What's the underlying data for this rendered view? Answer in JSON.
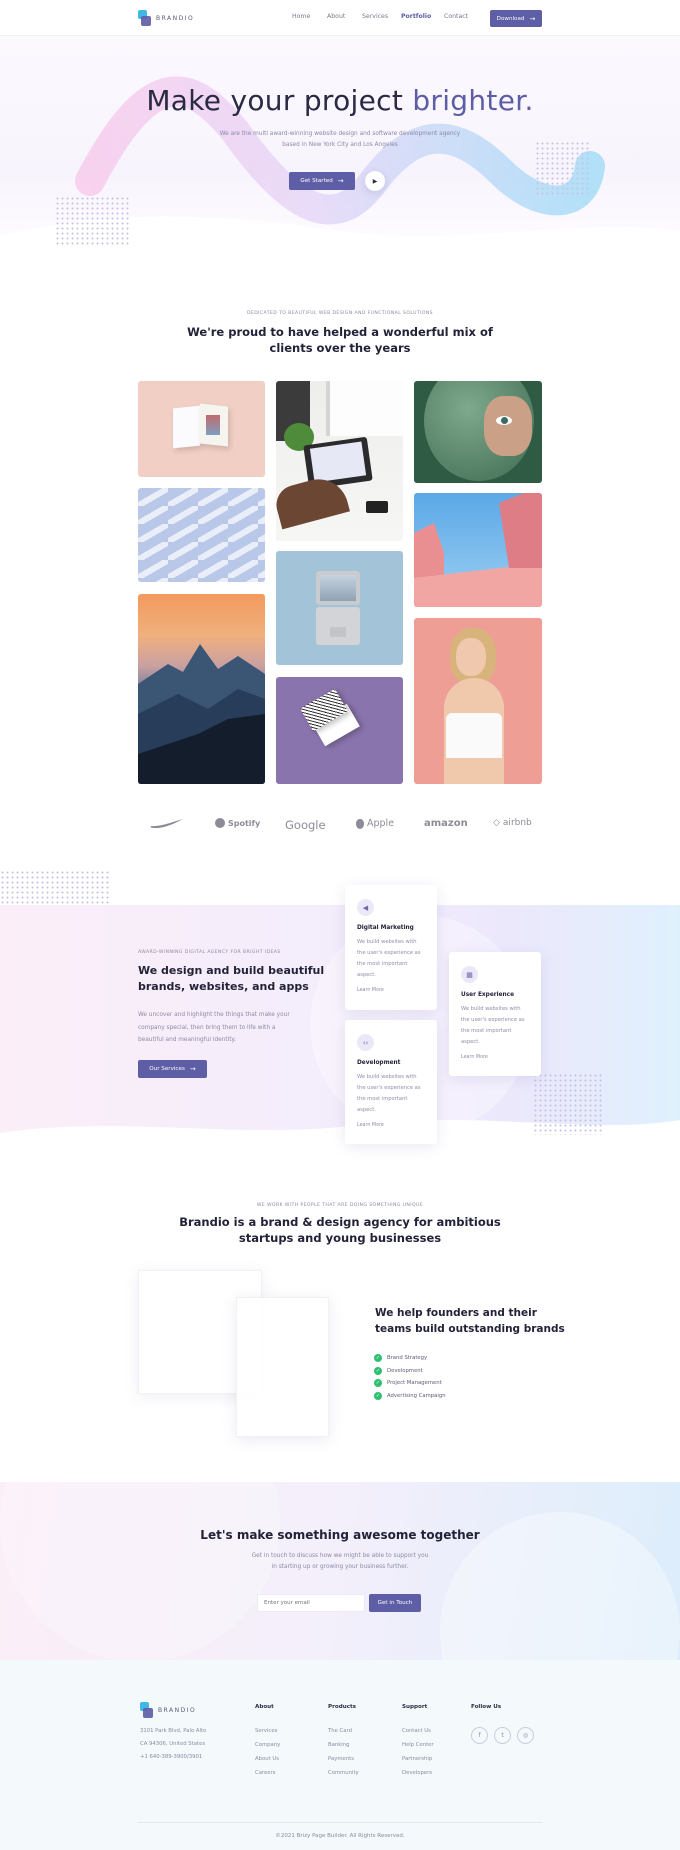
{
  "header": {
    "brand": "BRANDIO",
    "nav": [
      "Home",
      "About",
      "Services",
      "Portfolio",
      "Contact"
    ],
    "active_nav": "Portfolio",
    "download_label": "Download"
  },
  "hero": {
    "title_main": "Make your project ",
    "title_accent": "brighter.",
    "subtitle_line1": "We are the multi award-winning website design and software development agency",
    "subtitle_line2": "based in New York City and Los Angeles",
    "cta_label": "Get Started",
    "play_icon": "play-icon"
  },
  "clients": {
    "kicker": "DEDICATED TO BEAUTIFUL WEB DESIGN AND FUNCTIONAL SOLUTIONS",
    "title_line1": "We're proud to have helped a wonderful mix of",
    "title_line2": "clients over the years",
    "brands": [
      "Spotify",
      "Google",
      "Apple",
      "amazon",
      "airbnb"
    ],
    "brand_icons": [
      "nike-swoosh-icon",
      "spotify-icon",
      "apple-icon",
      "airbnb-icon"
    ]
  },
  "services": {
    "kicker": "AWARD-WINNING DIGITAL AGENCY FOR BRIGHT IDEAS",
    "title_line1": "We design and build beautiful",
    "title_line2": "brands, websites, and apps",
    "body_line1": "We uncover and highlight the things that make your",
    "body_line2": "company special, then bring them to life with a",
    "body_line3": "beautiful and meaningful identity.",
    "cta_label": "Our Services",
    "cards": [
      {
        "title": "Digital Marketing",
        "lines": [
          "We build websites with",
          "the user's experience as",
          "the most important",
          "aspect."
        ],
        "link": "Learn More",
        "icon": "megaphone-icon"
      },
      {
        "title": "User Experience",
        "lines": [
          "We build websites with",
          "the user's experience as",
          "the most important",
          "aspect."
        ],
        "link": "Learn More",
        "icon": "layout-icon"
      },
      {
        "title": "Development",
        "lines": [
          "We build websites with",
          "the user's experience as",
          "the most important",
          "aspect."
        ],
        "link": "Learn More",
        "icon": "code-icon"
      }
    ]
  },
  "agency": {
    "kicker": "WE WORK WITH PEOPLE THAT ARE DOING SOMETHING UNIQUE",
    "title_line1": "Brandio is a brand & design agency  for ambitious",
    "title_line2": "startups and young businesses",
    "feature_title_line1": "We help founders and their",
    "feature_title_line2": "teams build outstanding brands",
    "features": [
      "Brand Strategy",
      "Development",
      "Project Management",
      "Advertising Campaign"
    ]
  },
  "cta": {
    "title": "Let's make something awesome together",
    "body_line1": "Get in touch to discuss how we might be able to support you",
    "body_line2": "in starting up or growing your business further.",
    "email_placeholder": "Enter your email",
    "button_label": "Get in Touch"
  },
  "footer": {
    "brand": "BRANDIO",
    "address_line1": "3101 Park Blvd, Palo Alto",
    "address_line2": "CA 94306, United States",
    "phone": "+1 640-389-3900/3901",
    "columns": [
      {
        "heading": "About",
        "links": [
          "Services",
          "Company",
          "About Us",
          "Careers"
        ]
      },
      {
        "heading": "Products",
        "links": [
          "The Card",
          "Banking",
          "Payments",
          "Community"
        ]
      },
      {
        "heading": "Support",
        "links": [
          "Contact Us",
          "Help Center",
          "Partnership",
          "Developers"
        ]
      }
    ],
    "follow_heading": "Follow Us",
    "social_icons": [
      "facebook-icon",
      "twitter-icon",
      "instagram-icon"
    ],
    "copyright": "©2021 Brizy Page Builder. All Rights Reserved."
  },
  "colors": {
    "accent": "#5e5ea6",
    "check_green": "#2fbf71",
    "heading": "#23233b"
  }
}
